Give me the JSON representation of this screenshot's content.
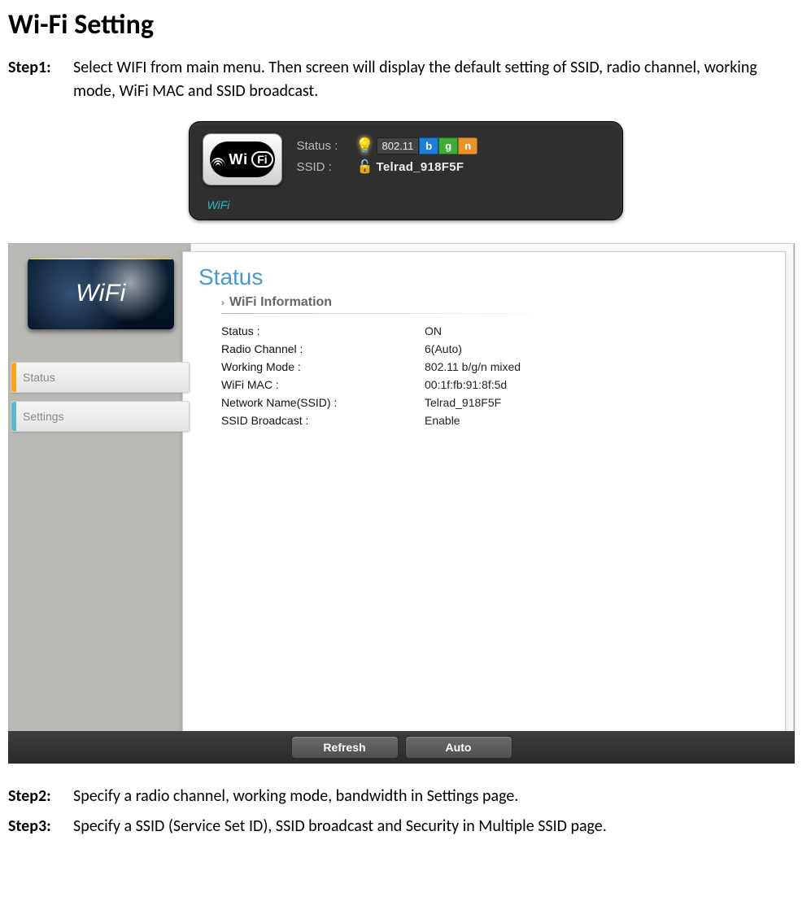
{
  "title": "Wi-Fi Setting",
  "steps": {
    "s1": {
      "label": "Step1:",
      "text": "Select WIFI from main menu. Then screen will display the default setting of SSID, radio channel, working mode, WiFi MAC and SSID broadcast."
    },
    "s2": {
      "label": "Step2:",
      "text": "Specify a radio channel, working mode, bandwidth in Settings page."
    },
    "s3": {
      "label": "Step3:",
      "text": "Specify a SSID (Service Set ID), SSID broadcast and Security in Multiple SSID page."
    }
  },
  "card": {
    "logo_text_wi": "Wi",
    "logo_text_fi": "Fi",
    "status_label": "Status :",
    "ssid_label": "SSID :",
    "proto_prefix": "802.11",
    "proto_b": "b",
    "proto_g": "g",
    "proto_n": "n",
    "ssid_value": "Telrad_918F5F",
    "footer": "WiFi"
  },
  "panel": {
    "header_tile": "WiFi",
    "side": {
      "status": "Status",
      "settings": "Settings"
    },
    "heading": "Status",
    "subhead": "WiFi Information",
    "rows": {
      "r0": {
        "k": "Status :",
        "v": "ON"
      },
      "r1": {
        "k": "Radio Channel :",
        "v": "6(Auto)"
      },
      "r2": {
        "k": "Working Mode :",
        "v": "802.11 b/g/n mixed"
      },
      "r3": {
        "k": "WiFi MAC :",
        "v": "00:1f:fb:91:8f:5d"
      },
      "r4": {
        "k": "Network Name(SSID) :",
        "v": "Telrad_918F5F"
      },
      "r5": {
        "k": "SSID Broadcast :",
        "v": "Enable"
      }
    },
    "buttons": {
      "refresh": "Refresh",
      "auto": "Auto"
    }
  }
}
